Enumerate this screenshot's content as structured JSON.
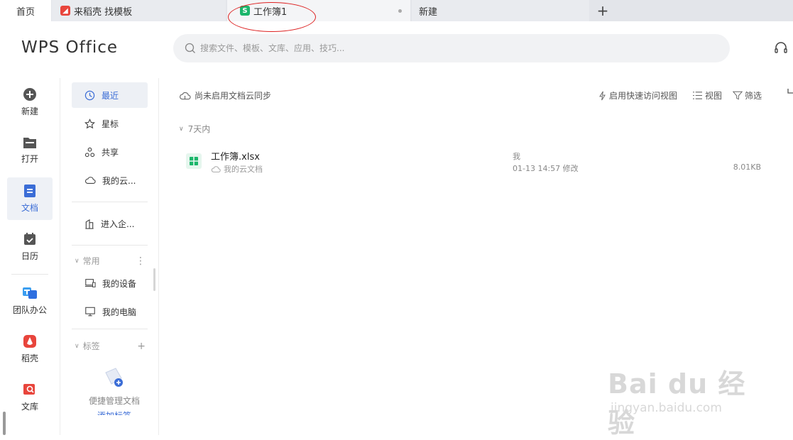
{
  "tabs": [
    {
      "label": "首页"
    },
    {
      "label": "来稻壳 找模板"
    },
    {
      "label": "工作簿1"
    },
    {
      "label": "新建"
    }
  ],
  "tab_icons": [
    "docer-icon",
    "spreadsheet-icon"
  ],
  "add_tab_label": "+",
  "header": {
    "logo": "WPS Office",
    "search_placeholder": "搜索文件、模板、文库、应用、技巧..."
  },
  "rail": [
    {
      "label": "新建",
      "icon": "plus-circle-icon"
    },
    {
      "label": "打开",
      "icon": "folder-icon"
    },
    {
      "label": "文档",
      "icon": "document-icon",
      "active": true
    },
    {
      "label": "日历",
      "icon": "calendar-icon"
    },
    {
      "label": "团队办公",
      "icon": "team-icon"
    },
    {
      "label": "稻壳",
      "icon": "docer-icon"
    },
    {
      "label": "文库",
      "icon": "library-icon"
    }
  ],
  "nav": {
    "items": [
      {
        "label": "最近",
        "icon": "clock-icon",
        "active": true
      },
      {
        "label": "星标",
        "icon": "star-icon"
      },
      {
        "label": "共享",
        "icon": "share-icon"
      },
      {
        "label": "我的云...",
        "icon": "cloud-icon"
      },
      {
        "label": "进入企...",
        "icon": "building-icon"
      }
    ],
    "common_section": "常用",
    "common_items": [
      {
        "label": "我的设备",
        "icon": "device-icon"
      },
      {
        "label": "我的电脑",
        "icon": "computer-icon"
      }
    ],
    "tags_section": "标签",
    "tags_empty_text": "便捷管理文档",
    "tags_add_text": "添加标签"
  },
  "main": {
    "cloud_sync_note": "尚未启用文档云同步",
    "toolbar": {
      "quick_view": "启用快速访问视图",
      "view": "视图",
      "filter": "筛选"
    },
    "group_label": "7天内",
    "files": [
      {
        "name": "工作簿.xlsx",
        "location": "我的云文档",
        "owner": "我",
        "modified": "01-13 14:57 修改",
        "size": "8.01KB"
      }
    ]
  },
  "watermark": {
    "top": "Bai du 经验",
    "bottom": "jingyan.baidu.com"
  },
  "colors": {
    "accent": "#3b6dd6",
    "tab_bar": "#e3e5ea",
    "annotation": "#dd2222"
  }
}
